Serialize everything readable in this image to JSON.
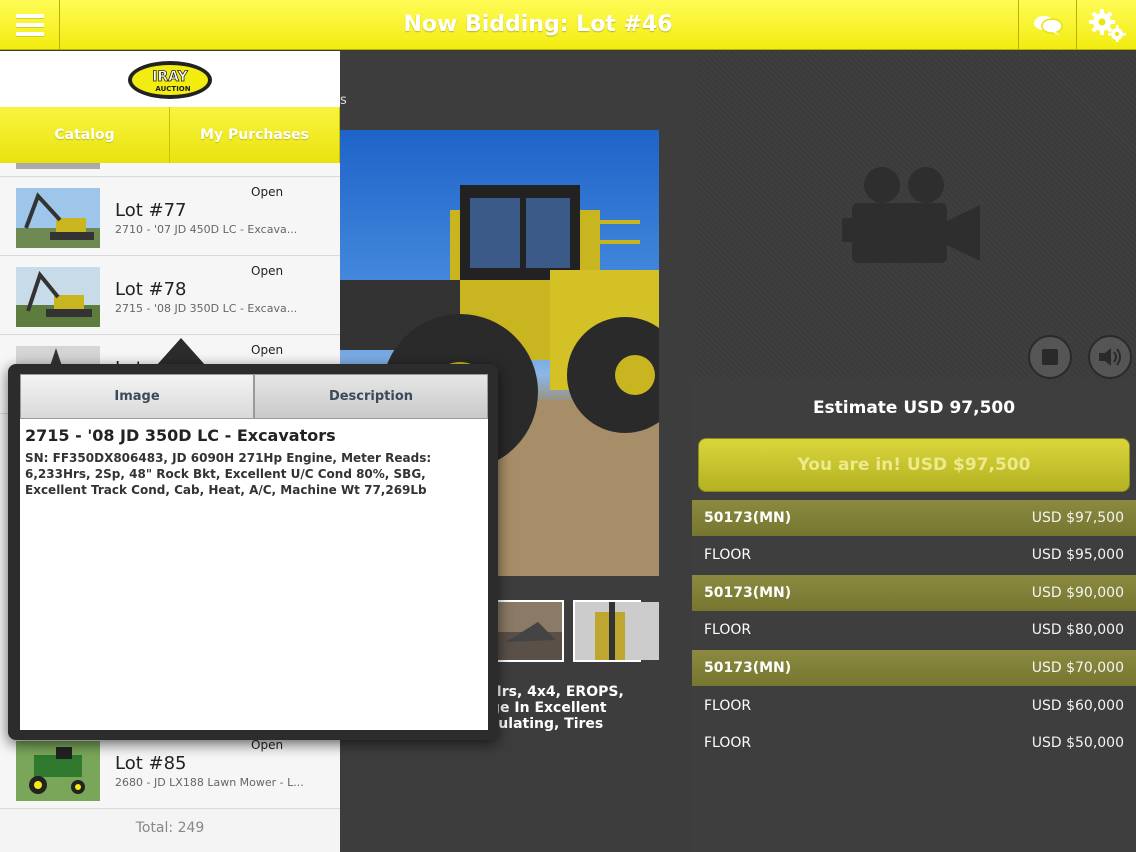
{
  "header": {
    "title": "Now Bidding: Lot #46"
  },
  "logo": {
    "text": "IRAY",
    "subtext": "AUCTION"
  },
  "tabs": {
    "catalog": "Catalog",
    "purchases": "My Purchases"
  },
  "lots": [
    {
      "status": "Open",
      "lot": "Lot #77",
      "desc": "2710 - '07 JD 450D LC - Excava..."
    },
    {
      "status": "Open",
      "lot": "Lot #78",
      "desc": "2715 - '08 JD 350D LC - Excava..."
    },
    {
      "status": "Open",
      "lot": "Lot",
      "desc": ""
    },
    {
      "status": "Open",
      "lot": "Lot #85",
      "desc": "2680 - JD LX188 Lawn Mower - L..."
    }
  ],
  "total": "Total: 249",
  "popover": {
    "tab_image": "Image",
    "tab_description": "Description",
    "title": "2715 - '08 JD 350D LC - Excavators",
    "text": "SN: FF350DX806483, JD 6090H 271Hp Engine, Meter Reads: 6,233Hrs, 2Sp, 48\" Rock Bkt, Excellent U/C Cond 80%, SBG, Excellent Track Cond, Cab, Heat, A/C, Machine Wt 77,269Lb"
  },
  "middle": {
    "subtitle_peek": "s",
    "desc_peek": [
      "Hrs, 4x4, EROPS,",
      "ge In Excellent",
      "culating, Tires"
    ]
  },
  "bidding": {
    "estimate": "Estimate USD 97,500",
    "button": "You are in! USD $97,500",
    "bids": [
      {
        "bidder": "50173(MN)",
        "amount": "USD $97,500",
        "highlight": true
      },
      {
        "bidder": "FLOOR",
        "amount": "USD $95,000",
        "highlight": false
      },
      {
        "bidder": "50173(MN)",
        "amount": "USD $90,000",
        "highlight": true
      },
      {
        "bidder": "FLOOR",
        "amount": "USD $80,000",
        "highlight": false
      },
      {
        "bidder": "50173(MN)",
        "amount": "USD $70,000",
        "highlight": true
      },
      {
        "bidder": "FLOOR",
        "amount": "USD $60,000",
        "highlight": false
      },
      {
        "bidder": "FLOOR",
        "amount": "USD $50,000",
        "highlight": false
      }
    ]
  },
  "colors": {
    "accent": "#f2ec10",
    "bid_highlight": "#7f7e35"
  },
  "icons": [
    "menu-icon",
    "chat-icon",
    "gear-icon",
    "video-camera-icon",
    "stop-icon",
    "speaker-icon"
  ]
}
